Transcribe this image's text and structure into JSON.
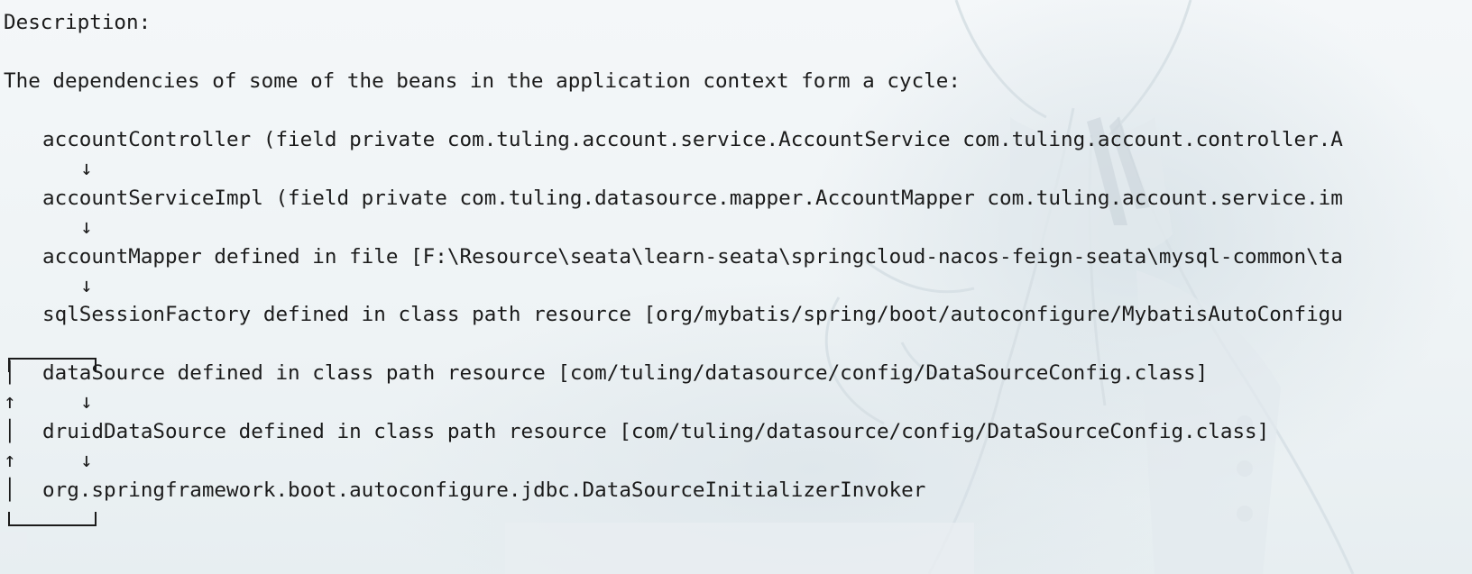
{
  "header": {
    "title": "Description:"
  },
  "message": "The dependencies of some of the beans in the application context form a cycle:",
  "cycle": [
    {
      "bean": "accountController",
      "text": "accountController (field private com.tuling.account.service.AccountService com.tuling.account.controller.A"
    },
    {
      "bean": "accountServiceImpl",
      "text": "accountServiceImpl (field private com.tuling.datasource.mapper.AccountMapper com.tuling.account.service.im"
    },
    {
      "bean": "accountMapper",
      "text": "accountMapper defined in file [F:\\Resource\\seata\\learn-seata\\springcloud-nacos-feign-seata\\mysql-common\\ta"
    },
    {
      "bean": "sqlSessionFactory",
      "text": "sqlSessionFactory defined in class path resource [org/mybatis/spring/boot/autoconfigure/MybatisAutoConfigu"
    },
    {
      "bean": "dataSource",
      "text": "dataSource defined in class path resource [com/tuling/datasource/config/DataSourceConfig.class]"
    },
    {
      "bean": "druidDataSource",
      "text": "druidDataSource defined in class path resource [com/tuling/datasource/config/DataSourceConfig.class]"
    },
    {
      "bean": "DataSourceInitializerInvoker",
      "text": "org.springframework.boot.autoconfigure.jdbc.DataSourceInitializerInvoker"
    }
  ],
  "glyphs": {
    "down_arrow": "↓",
    "up_arrow": "↑",
    "vertical_bar": "│"
  }
}
